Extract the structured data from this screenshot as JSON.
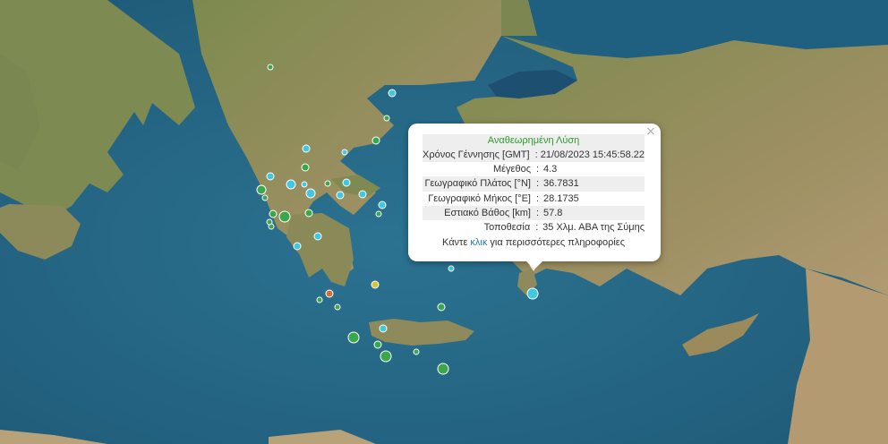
{
  "popup": {
    "title": "Αναθεωρημένη Λύση",
    "rows": [
      {
        "label": "Χρόνος Γέννησης [GMT]",
        "value": "21/08/2023 15:45:58.22"
      },
      {
        "label": "Μέγεθος",
        "value": "4.3"
      },
      {
        "label": "Γεωγραφικό Πλάτος [°N]",
        "value": "36.7831"
      },
      {
        "label": "Γεωγραφικό Μήκος [°E]",
        "value": "28.1735"
      },
      {
        "label": "Εστιακό Βάθος [km]",
        "value": "57.8"
      },
      {
        "label": "Τοποθεσία",
        "value": "35 Χλμ. ΑΒΑ της Σύμης"
      }
    ],
    "separator": ":",
    "more_prefix": "Κάντε",
    "more_link": "κλικ",
    "more_suffix": "για περισσότερες πληροφορίες",
    "close_glyph": "×"
  },
  "colors": {
    "sea": "#2a6f8f",
    "land": "#8a8a5a",
    "cyan_marker": "#41c8e0",
    "green_marker": "#3aa84a",
    "yellow_marker": "#d8c53a",
    "orange_marker": "#d0702a",
    "selected_marker": "#f0c040"
  }
}
